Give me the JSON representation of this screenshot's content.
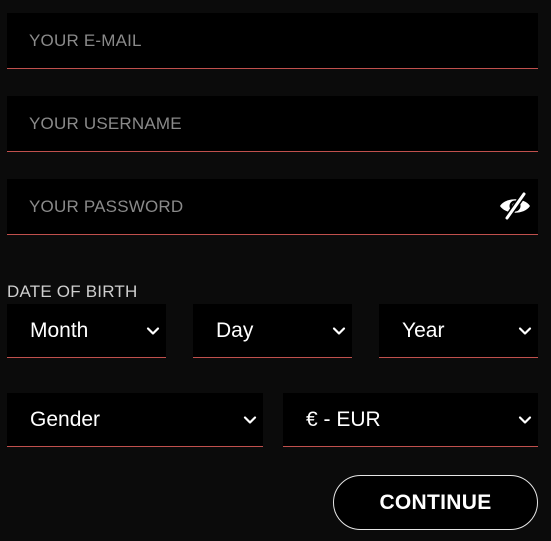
{
  "form": {
    "email": {
      "placeholder": "YOUR E-MAIL",
      "value": ""
    },
    "username": {
      "placeholder": "YOUR USERNAME",
      "value": ""
    },
    "password": {
      "placeholder": "YOUR PASSWORD",
      "value": "",
      "toggle_icon": "eye-slash-icon"
    },
    "dob_label": "DATE OF BIRTH",
    "month": {
      "value": "Month",
      "icon": "chevron-down-icon"
    },
    "day": {
      "value": "Day",
      "icon": "chevron-down-icon"
    },
    "year": {
      "value": "Year",
      "icon": "chevron-down-icon"
    },
    "gender": {
      "value": "Gender",
      "icon": "chevron-down-icon"
    },
    "currency": {
      "value": "€ - EUR",
      "icon": "chevron-down-icon"
    },
    "continue_label": "CONTINUE"
  },
  "colors": {
    "background": "#0b0b0b",
    "field_background": "#000000",
    "field_underline": "#c0504d",
    "placeholder_text": "#8a8a8a",
    "label_text": "#cfcfcf",
    "primary_text": "#ffffff",
    "button_border": "#e6e6e6"
  }
}
